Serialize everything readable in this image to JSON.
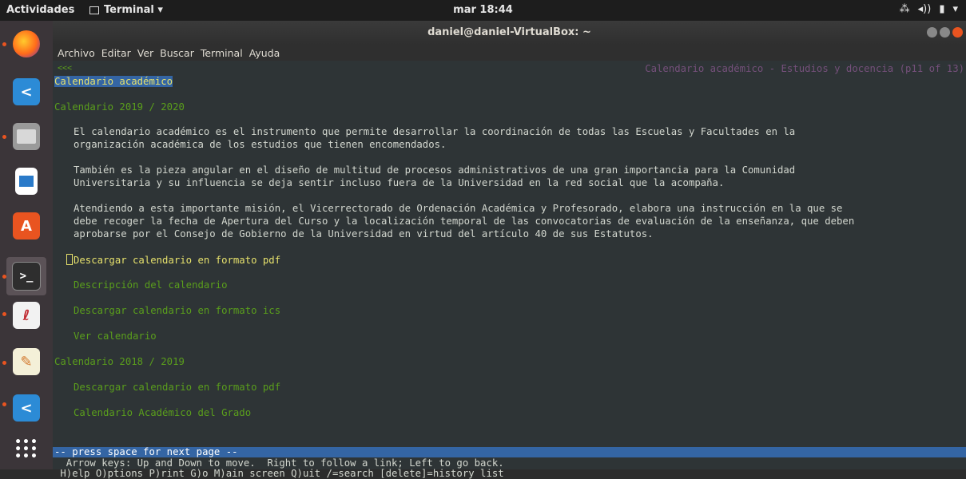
{
  "topbar": {
    "activities": "Actividades",
    "app_menu": "Terminal ▾",
    "clock": "mar 18:44",
    "tray": [
      "network-icon",
      "volume-icon",
      "battery-icon",
      "▾"
    ]
  },
  "dock": {
    "items": [
      "firefox-icon",
      "vscode-icon",
      "files-icon",
      "writer-icon",
      "software-center-icon",
      "terminal-icon",
      "evince-icon",
      "text-editor-icon",
      "vscode-icon-2",
      "app-grid-icon"
    ]
  },
  "window": {
    "title": "daniel@daniel-VirtualBox: ~",
    "menu": [
      "Archivo",
      "Editar",
      "Ver",
      "Buscar",
      "Terminal",
      "Ayuda"
    ]
  },
  "terminal": {
    "back_arrow": "<<<",
    "page_info": "Calendario académico - Estudios y docencia (p11 of 13)",
    "heading": "Calendario académico",
    "section1": "Calendario 2019 / 2020",
    "para1_l1": "El calendario académico es el instrumento que permite desarrollar la coordinación de todas las Escuelas y Facultades en la",
    "para1_l2": "organización académica de los estudios que tienen encomendados.",
    "para2_l1": "También es la pieza angular en el diseño de multitud de procesos administrativos de una gran importancia para la Comunidad",
    "para2_l2": "Universitaria y su influencia se deja sentir incluso fuera de la Universidad en la red social que la acompaña.",
    "para3_l1": "Atendiendo a esta importante misión, el Vicerrectorado de Ordenación Académica y Profesorado, elabora una instrucción en la que se",
    "para3_l2": "debe recoger la fecha de Apertura del Curso y la localización temporal de las convocatorias de evaluación de la enseñanza, que deben",
    "para3_l3": "aprobarse por el Consejo de Gobierno de la Universidad en virtud del artículo 40 de sus Estatutos.",
    "link_selected": "Descargar calendario en formato pdf",
    "link_desc": "Descripción del calendario",
    "link_ics": "Descargar calendario en formato ics",
    "link_ver": "Ver calendario",
    "section2": "Calendario 2018 / 2019",
    "link_pdf2": "Descargar calendario en formato pdf",
    "link_grado": "Calendario Académico del Grado",
    "status": "-- press space for next page --",
    "help1": "  Arrow keys: Up and Down to move.  Right to follow a link; Left to go back.",
    "help2": " H)elp O)ptions P)rint G)o M)ain screen Q)uit /=search [delete]=history list"
  }
}
